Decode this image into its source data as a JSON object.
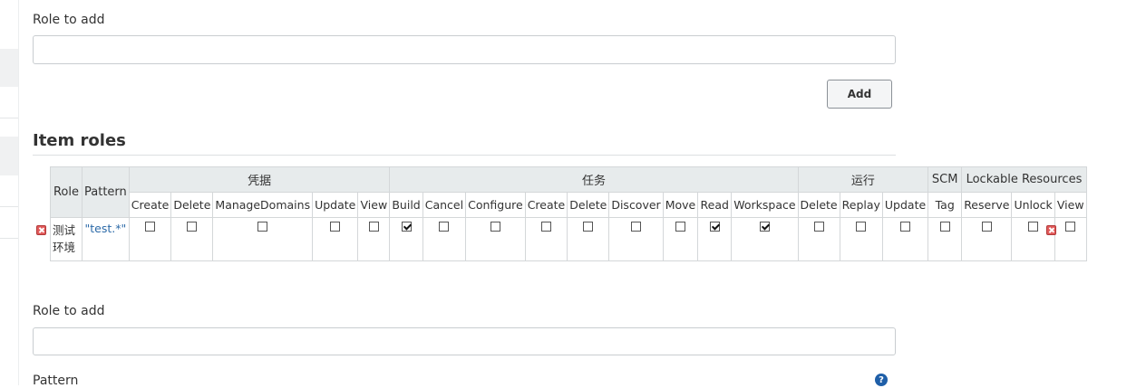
{
  "top_form": {
    "role_label": "Role to add",
    "role_value": "",
    "add_label": "Add"
  },
  "item_roles": {
    "title": "Item roles",
    "headers": {
      "role": "Role",
      "pattern": "Pattern",
      "groups": [
        "凭据",
        "任务",
        "运行",
        "SCM",
        "Lockable Resources"
      ],
      "permissions": [
        "Create",
        "Delete",
        "ManageDomains",
        "Update",
        "View",
        "Build",
        "Cancel",
        "Configure",
        "Create",
        "Delete",
        "Discover",
        "Move",
        "Read",
        "Workspace",
        "Delete",
        "Replay",
        "Update",
        "Tag",
        "Reserve",
        "Unlock",
        "View"
      ]
    },
    "rows": [
      {
        "role_line1": "测试",
        "role_line2": "环境",
        "pattern": "\"test.*\"",
        "checked": [
          false,
          false,
          false,
          false,
          false,
          true,
          false,
          false,
          false,
          false,
          false,
          false,
          true,
          true,
          false,
          false,
          false,
          false,
          false,
          false,
          false
        ]
      }
    ]
  },
  "bottom_form": {
    "role_label": "Role to add",
    "role_value": "",
    "pattern_label": "Pattern",
    "help_glyph": "?"
  },
  "icons": {
    "delete": "delete-icon",
    "help": "help-icon"
  },
  "colors": {
    "pattern_link": "#2c6aa8",
    "delete_icon": "#e15a5a",
    "help_icon": "#1f5fa8",
    "header_bg": "#e7ebec"
  }
}
